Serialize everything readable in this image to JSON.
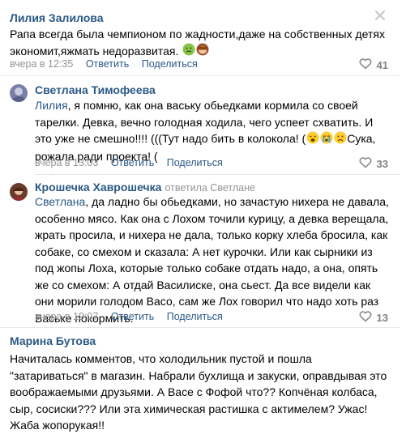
{
  "comments": [
    {
      "author": "Лилия Залилова",
      "text": "Рапа всегда была чемпионом по жадности,даже на собственных детях экономит,яжмать недоразвитая.",
      "time": "вчера в 12:35",
      "reply_label": "Ответить",
      "share_label": "Поделиться",
      "likes": "41"
    },
    {
      "author": "Светлана Тимофеева",
      "mention": "Лилия",
      "text_1": ", я помню, как она ваську обьедками кормила со своей тарелки. Девка, вечно голодная ходила, чего успеет схватить. И это уже не смешно!!!! (((Тут надо бить в колокола! (",
      "text_2": "Сука, рожала ради проекта! (",
      "time": "вчера в 13:03",
      "reply_label": "Ответить",
      "share_label": "Поделиться",
      "likes": "33"
    },
    {
      "author": "Крошечка Хаврошечка",
      "reply_to": "ответила Светлане",
      "mention": "Светлана",
      "text": ", да ладно бы обьедками, но зачастую нихера не давала, особенно мясо. Как она с Лохом точили курицу, а девка верещала, жрать просила, и нихера не дала, только корку хлеба бросила, как собаке, со смехом и сказала: А нет курочки. Или как сырники из под жопы Лоха, которые только собаке отдать надо, а она, опять же со смехом: А отдай Василиске, она сьест. Да все видели как они морили голодом Васо, сам же Лох говорил что надо хоть раз Ваське покормить.",
      "time": "вчера в 19:07",
      "reply_label": "Ответить",
      "share_label": "Поделиться",
      "likes": "13"
    },
    {
      "author": "Марина Бутова",
      "text": "Начиталась комментов, что холодильник пустой и пошла \"затариваться\" в магазин. Набрали бухлища и закуски, оправдывая это воображаемыми друзьями. А Васе с Фофой что?? Копчёная колбаса, сыр, сосиски??? Или эта химическая растишка с актимелем? Ужас! Жаба жопорукая!!"
    }
  ],
  "colors": {
    "link": "#2a5885",
    "meta": "#939393",
    "divider": "#e7e8ec"
  },
  "icons": {
    "close": "close-icon",
    "like": "heart-icon"
  }
}
